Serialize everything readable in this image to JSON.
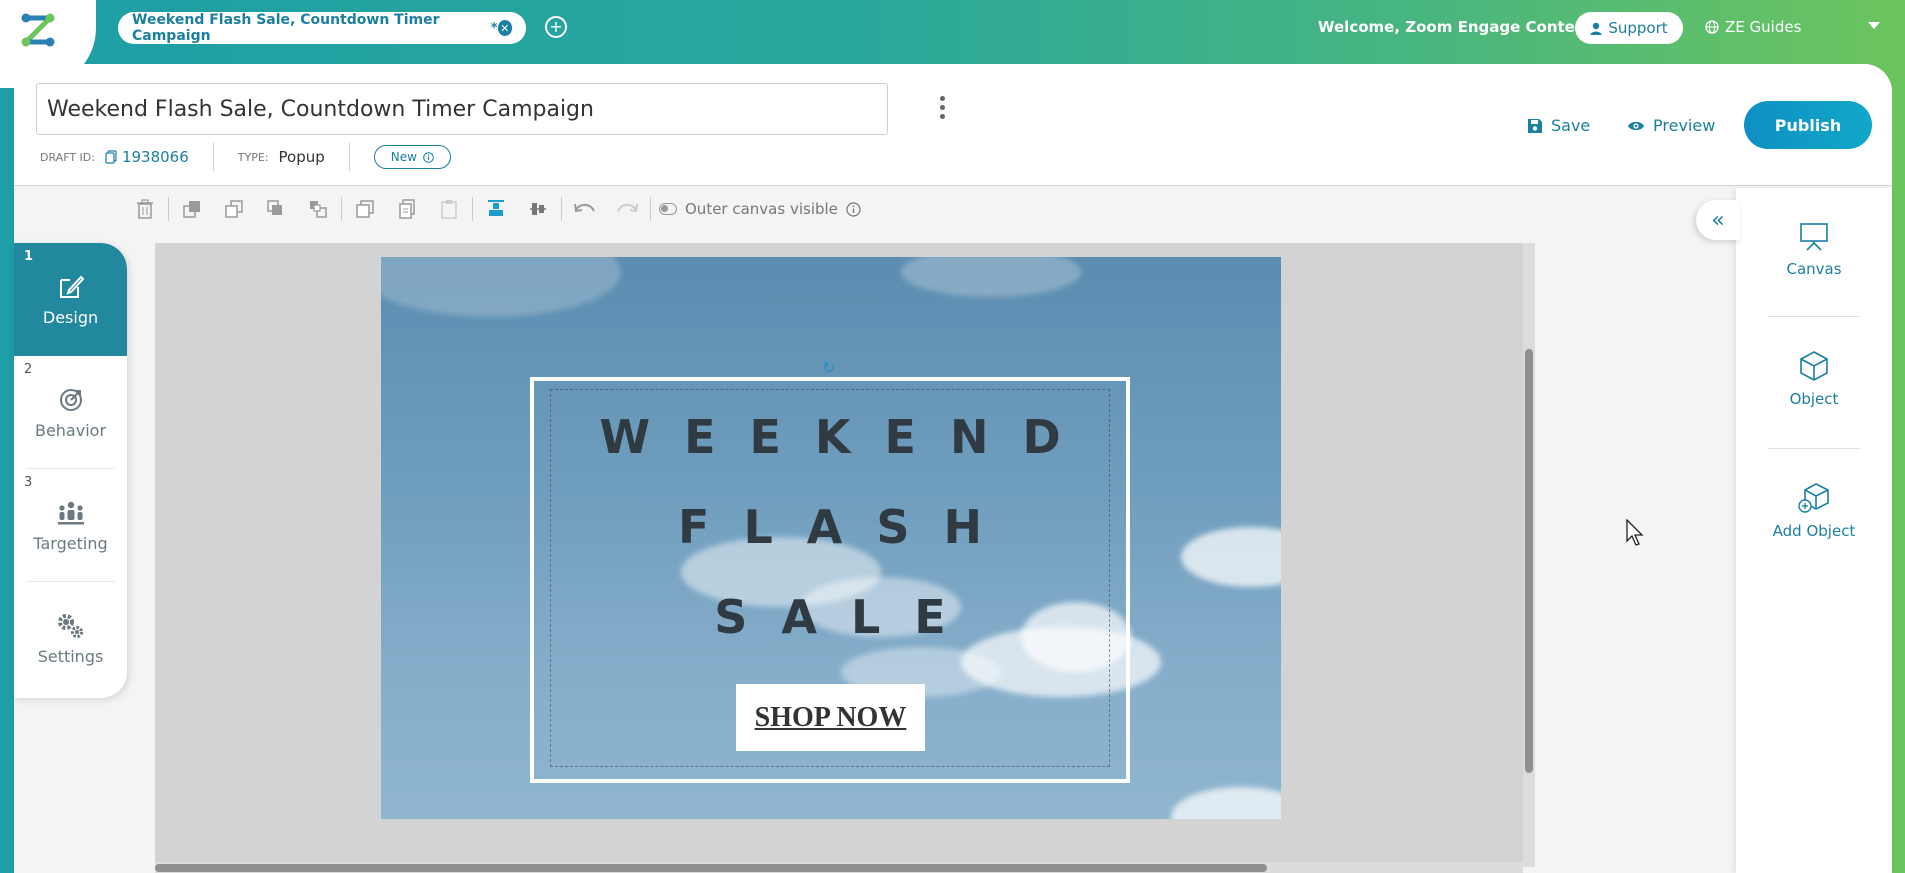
{
  "app": {
    "tab_title": "Weekend Flash Sale, Countdown Timer Campaign",
    "tab_dirty_marker": "*",
    "welcome": "Welcome,  Zoom Engage Content",
    "support_label": "Support",
    "guides_label": "ZE Guides"
  },
  "header": {
    "campaign_title": "Weekend Flash Sale, Countdown Timer Campaign",
    "draft_id_label": "DRAFT ID:",
    "draft_id": "1938066",
    "type_label": "TYPE:",
    "type_value": "Popup",
    "status_badge": "New",
    "save_label": "Save",
    "preview_label": "Preview",
    "publish_label": "Publish"
  },
  "toolbar": {
    "outer_canvas_label": "Outer canvas visible"
  },
  "steps": [
    {
      "num": "1",
      "label": "Design",
      "icon": "edit-icon",
      "active": true
    },
    {
      "num": "2",
      "label": "Behavior",
      "icon": "behavior-icon",
      "active": false
    },
    {
      "num": "3",
      "label": "Targeting",
      "icon": "targeting-icon",
      "active": false
    },
    {
      "num": "",
      "label": "Settings",
      "icon": "gears-icon",
      "active": false
    }
  ],
  "canvas": {
    "headline_1": "WEEKEND",
    "headline_2": "FLASH",
    "headline_3": "SALE",
    "cta": "SHOP NOW"
  },
  "right_panel": {
    "canvas_label": "Canvas",
    "object_label": "Object",
    "add_object_label": "Add Object"
  },
  "colors": {
    "accent": "#1a7fa0",
    "active_step": "#22889e",
    "publish": "#10a8c8"
  }
}
